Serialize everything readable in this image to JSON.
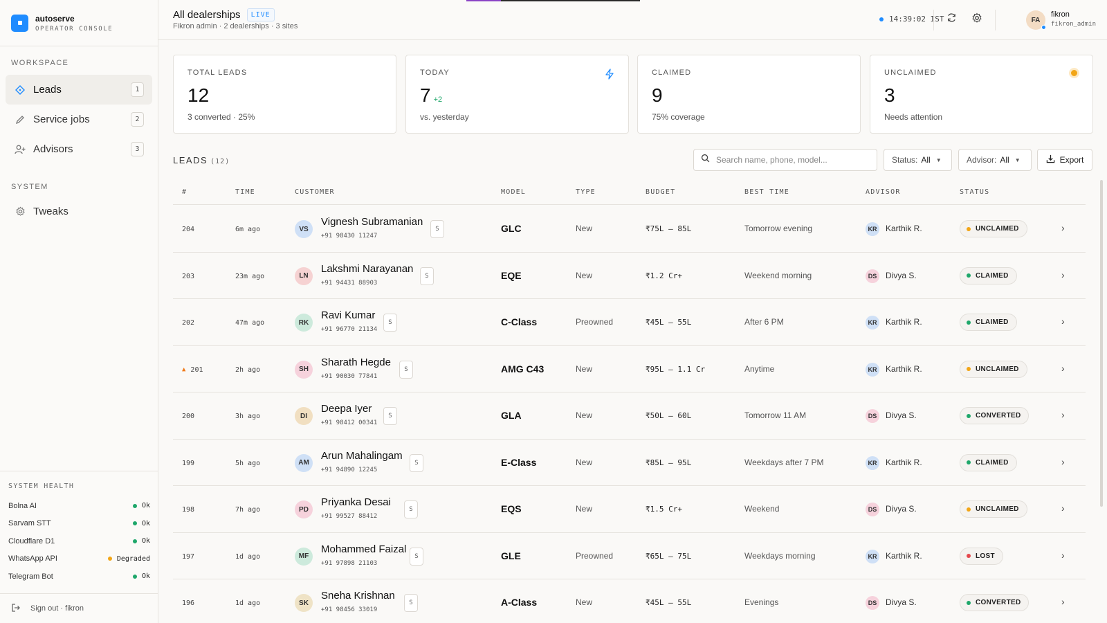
{
  "brand": {
    "name": "autoserve",
    "subtitle": "OPERATOR CONSOLE"
  },
  "sidebar": {
    "workspace_label": "WORKSPACE",
    "items": [
      {
        "label": "Leads",
        "count": "1",
        "icon": "diamond-icon"
      },
      {
        "label": "Service jobs",
        "count": "2",
        "icon": "pencil-icon"
      },
      {
        "label": "Advisors",
        "count": "3",
        "icon": "user-plus-icon"
      }
    ],
    "system_label": "SYSTEM",
    "system_items": [
      {
        "label": "Tweaks",
        "icon": "gear-icon"
      }
    ]
  },
  "health": {
    "title": "SYSTEM HEALTH",
    "services": [
      {
        "name": "Bolna AI",
        "status": "Ok",
        "color": "#1ea76a"
      },
      {
        "name": "Sarvam STT",
        "status": "Ok",
        "color": "#1ea76a"
      },
      {
        "name": "Cloudflare D1",
        "status": "Ok",
        "color": "#1ea76a"
      },
      {
        "name": "WhatsApp API",
        "status": "Degraded",
        "color": "#f2a516"
      },
      {
        "name": "Telegram Bot",
        "status": "Ok",
        "color": "#1ea76a"
      }
    ]
  },
  "signout": {
    "label": "Sign out · fikron"
  },
  "header": {
    "title": "All dealerships",
    "live": "LIVE",
    "subtitle": "Fikron admin · 2 dealerships · 3 sites",
    "clock": "14:39:02 IST",
    "user": {
      "initials": "FA",
      "name": "fikron",
      "handle": "fikron_admin"
    }
  },
  "stats": [
    {
      "label": "TOTAL LEADS",
      "value": "12",
      "delta": "",
      "sub": "3 converted · 25%"
    },
    {
      "label": "TODAY",
      "value": "7",
      "delta": "+2",
      "sub": "vs. yesterday"
    },
    {
      "label": "CLAIMED",
      "value": "9",
      "delta": "",
      "sub": "75% coverage"
    },
    {
      "label": "UNCLAIMED",
      "value": "3",
      "delta": "",
      "sub": "Needs attention"
    }
  ],
  "leads": {
    "title": "LEADS",
    "count": "(12)",
    "search_placeholder": "Search name, phone, model...",
    "status_filter": {
      "label": "Status:",
      "value": "All"
    },
    "advisor_filter": {
      "label": "Advisor:",
      "value": "All"
    },
    "export_label": "Export",
    "columns": [
      "#",
      "TIME",
      "CUSTOMER",
      "MODEL",
      "TYPE",
      "BUDGET",
      "BEST TIME",
      "ADVISOR",
      "STATUS"
    ],
    "rows": [
      {
        "id": "204",
        "time": "6m ago",
        "initials": "VS",
        "name": "Vignesh Subramanian",
        "phone": "+91 98430 11247",
        "s": "S",
        "model": "GLC",
        "type": "New",
        "budget": "₹75L – 85L",
        "best": "Tomorrow evening",
        "adv_initials": "KR",
        "advisor": "Karthik R.",
        "status": "UNCLAIMED",
        "hot": false
      },
      {
        "id": "203",
        "time": "23m ago",
        "initials": "LN",
        "name": "Lakshmi Narayanan",
        "phone": "+91 94431 88903",
        "s": "S",
        "model": "EQE",
        "type": "New",
        "budget": "₹1.2 Cr+",
        "best": "Weekend morning",
        "adv_initials": "DS",
        "advisor": "Divya S.",
        "status": "CLAIMED",
        "hot": false
      },
      {
        "id": "202",
        "time": "47m ago",
        "initials": "RK",
        "name": "Ravi Kumar",
        "phone": "+91 96770 21134",
        "s": "S",
        "model": "C-Class",
        "type": "Preowned",
        "budget": "₹45L – 55L",
        "best": "After 6 PM",
        "adv_initials": "KR",
        "advisor": "Karthik R.",
        "status": "CLAIMED",
        "hot": false
      },
      {
        "id": "201",
        "time": "2h ago",
        "initials": "SH",
        "name": "Sharath Hegde",
        "phone": "+91 90030 77841",
        "s": "S",
        "model": "AMG C43",
        "type": "New",
        "budget": "₹95L – 1.1 Cr",
        "best": "Anytime",
        "adv_initials": "KR",
        "advisor": "Karthik R.",
        "status": "UNCLAIMED",
        "hot": true
      },
      {
        "id": "200",
        "time": "3h ago",
        "initials": "DI",
        "name": "Deepa Iyer",
        "phone": "+91 98412 00341",
        "s": "S",
        "model": "GLA",
        "type": "New",
        "budget": "₹50L – 60L",
        "best": "Tomorrow 11 AM",
        "adv_initials": "DS",
        "advisor": "Divya S.",
        "status": "CONVERTED",
        "hot": false
      },
      {
        "id": "199",
        "time": "5h ago",
        "initials": "AM",
        "name": "Arun Mahalingam",
        "phone": "+91 94890 12245",
        "s": "S",
        "model": "E-Class",
        "type": "New",
        "budget": "₹85L – 95L",
        "best": "Weekdays after 7 PM",
        "adv_initials": "KR",
        "advisor": "Karthik R.",
        "status": "CLAIMED",
        "hot": false
      },
      {
        "id": "198",
        "time": "7h ago",
        "initials": "PD",
        "name": "Priyanka Desai",
        "phone": "+91 99527 88412",
        "s": "S",
        "model": "EQS",
        "type": "New",
        "budget": "₹1.5 Cr+",
        "best": "Weekend",
        "adv_initials": "DS",
        "advisor": "Divya S.",
        "status": "UNCLAIMED",
        "hot": false
      },
      {
        "id": "197",
        "time": "1d ago",
        "initials": "MF",
        "name": "Mohammed Faizal",
        "phone": "+91 97898 21103",
        "s": "S",
        "model": "GLE",
        "type": "Preowned",
        "budget": "₹65L – 75L",
        "best": "Weekdays morning",
        "adv_initials": "KR",
        "advisor": "Karthik R.",
        "status": "LOST",
        "hot": false
      },
      {
        "id": "196",
        "time": "1d ago",
        "initials": "SK",
        "name": "Sneha Krishnan",
        "phone": "+91 98456 33019",
        "s": "S",
        "model": "A-Class",
        "type": "New",
        "budget": "₹45L – 55L",
        "best": "Evenings",
        "adv_initials": "DS",
        "advisor": "Divya S.",
        "status": "CONVERTED",
        "hot": false
      }
    ]
  },
  "colors": {
    "accent": "#1f8cff",
    "status": {
      "UNCLAIMED": "#f2a516",
      "CLAIMED": "#1ea76a",
      "CONVERTED": "#1ea76a",
      "LOST": "#e5484d"
    },
    "avatar": {
      "VS": "#cfe0f6",
      "LN": "#f6d2d2",
      "RK": "#cdeadc",
      "SH": "#f6d2dc",
      "DI": "#f1dfc1",
      "AM": "#cfe0f6",
      "PD": "#f6d2dc",
      "MF": "#cdeadc",
      "SK": "#efe3c6",
      "KR": "#cfe0f6",
      "DS": "#f6d2dc"
    }
  }
}
